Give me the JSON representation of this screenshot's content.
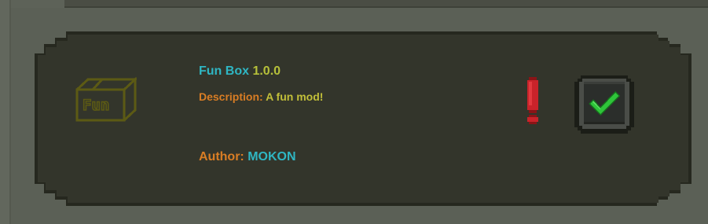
{
  "mod": {
    "name": "Fun Box",
    "version": "1.0.0",
    "description_label": "Description:",
    "description": "A fun mod!",
    "author_label": "Author:",
    "author": "MOKON",
    "icon_text": "Fun"
  },
  "status": {
    "warning_icon": "exclamation-icon",
    "enabled": true,
    "toggle_icon": "checkmark-icon"
  },
  "colors": {
    "name": "#2fb6c3",
    "version": "#b6c03a",
    "label": "#d97d24",
    "description": "#c2bf39",
    "author": "#2fb6c3",
    "warning": "#c9232a",
    "check": "#2fc43a"
  }
}
